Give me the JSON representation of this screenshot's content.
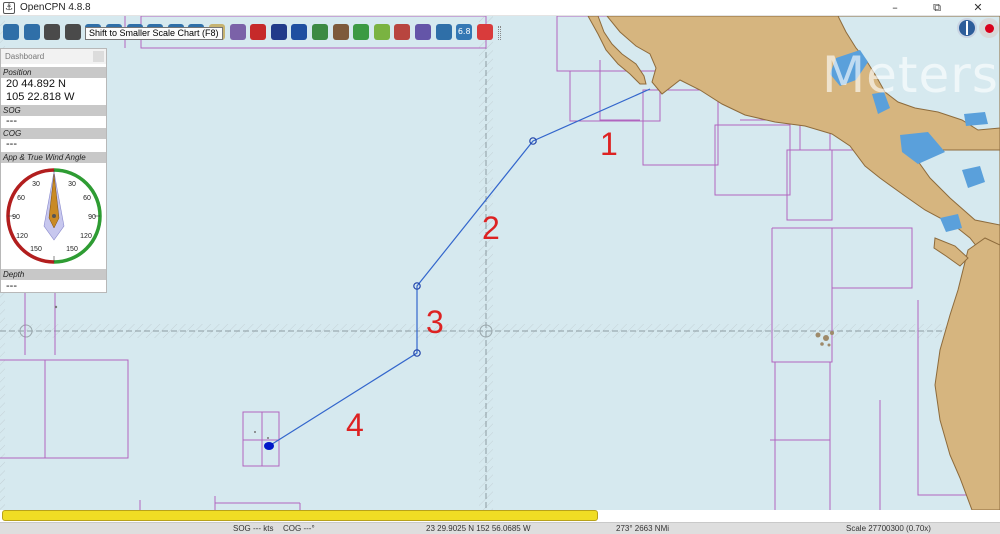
{
  "window": {
    "title": "OpenCPN 4.8.8",
    "icon": "opencpn-app-icon",
    "minimize_glyph": "–",
    "restore_glyph": "⧉",
    "close_glyph": "✕"
  },
  "toolbar": {
    "tooltip": "Shift to Smaller Scale Chart (F8)",
    "zoom_readout": "6.8",
    "tools": [
      {
        "icon": "zoom-in-icon",
        "color": "#2f6fa8"
      },
      {
        "icon": "zoom-out-icon",
        "color": "#2f6fa8"
      },
      {
        "icon": "chart-scale-up-icon",
        "color": "#4a4a4a"
      },
      {
        "icon": "chart-scale-down-icon",
        "color": "#4a4a4a"
      },
      {
        "icon": "route-icon",
        "color": "#2f6fa8"
      },
      {
        "icon": "track-icon",
        "color": "#2f6fa8"
      },
      {
        "icon": "select-icon",
        "color": "#2f6fa8"
      },
      {
        "icon": "settings-icon",
        "color": "#2f6fa8"
      },
      {
        "icon": "dashboard-icon",
        "color": "#2f6fa8"
      },
      {
        "icon": "text-icon",
        "color": "#2f6fa8"
      },
      {
        "icon": "chart-quilting-icon",
        "color": "#c6b370"
      },
      {
        "icon": "route-manager-icon",
        "color": "#7b62a8"
      },
      {
        "icon": "wave-icon",
        "color": "#c62a2a"
      },
      {
        "icon": "tide-icon",
        "color": "#213b8a"
      },
      {
        "icon": "help-icon",
        "color": "#1f4fa0"
      },
      {
        "icon": "crosshair-icon",
        "color": "#3c8a43"
      },
      {
        "icon": "weather-icon",
        "color": "#7d5a3b"
      },
      {
        "icon": "plus-icon",
        "color": "#3c9a43"
      },
      {
        "icon": "target-icon",
        "color": "#7ab341"
      },
      {
        "icon": "map-icon",
        "color": "#b8453f"
      },
      {
        "icon": "navigate-icon",
        "color": "#6455a8"
      },
      {
        "icon": "measure-icon",
        "color": "#2f6fa8"
      },
      {
        "icon": "zoom-readout-icon",
        "color": "#3478b4"
      },
      {
        "icon": "lifebuoy-icon",
        "color": "#d93b3b"
      }
    ]
  },
  "map": {
    "watermark": "Meters",
    "route_labels": [
      "1",
      "2",
      "3",
      "4"
    ],
    "colors": {
      "sea": "#d6e9ef",
      "land": "#d6b57f",
      "coast": "#8d6b3c",
      "lake": "#5aa0db",
      "chart_outline": "#b165bf",
      "route": "#3366cc",
      "label": "#dd2222"
    }
  },
  "dashboard": {
    "title": "Dashboard",
    "position_label": "Position",
    "lat": "20 44.892 N",
    "lon": "105 22.818 W",
    "sog_label": "SOG",
    "sog_value": "---",
    "cog_label": "COG",
    "cog_value": "---",
    "wind_label": "App & True Wind Angle",
    "depth_label": "Depth",
    "depth_value": "---",
    "wind_ticks": [
      "30",
      "30",
      "60",
      "60",
      "90",
      "90",
      "120",
      "120",
      "150",
      "150"
    ]
  },
  "status": {
    "sog": "SOG --- kts",
    "cog": "COG ---°",
    "cursor": "23 29.9025 N   152 56.0685 W",
    "bearing": "273°  2663 NMi",
    "scale": "Scale 27700300 (0.70x)",
    "progress": 0.6
  }
}
